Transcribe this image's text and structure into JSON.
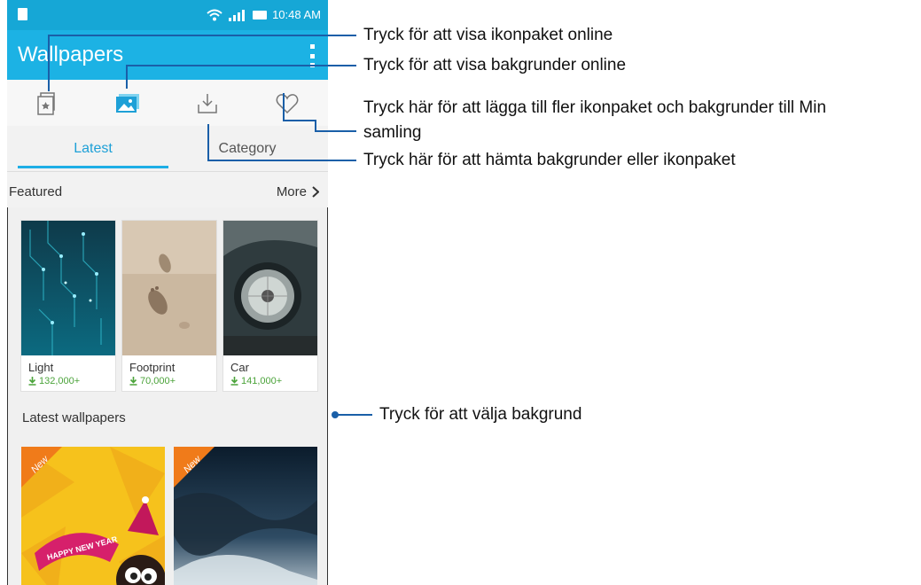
{
  "status_bar": {
    "time": "10:48 AM"
  },
  "app_bar": {
    "title": "Wallpapers"
  },
  "icon_bar": [
    "iconpack-icon",
    "image-icon",
    "download-icon",
    "heart-icon"
  ],
  "tabs": [
    {
      "label": "Latest",
      "active": true
    },
    {
      "label": "Category",
      "active": false
    }
  ],
  "featured": {
    "label": "Featured",
    "more_label": "More"
  },
  "cards": [
    {
      "name": "Light",
      "count": "132,000+"
    },
    {
      "name": "Footprint",
      "count": "70,000+"
    },
    {
      "name": "Car",
      "count": "141,000+"
    }
  ],
  "latest_wallpapers": {
    "label": "Latest wallpapers",
    "badges": [
      "New",
      "New"
    ],
    "card1_text": "HAPPY NEW YEAR"
  },
  "callouts": {
    "c1": "Tryck för att visa ikonpaket online",
    "c2": "Tryck för att visa bakgrunder online",
    "c3a": "Tryck här för att lägga till fler ikonpaket och bakgrunder till Min",
    "c3b": "samling",
    "c4": "Tryck här för att hämta bakgrunder eller ikonpaket",
    "c5": "Tryck för att välja bakgrund"
  },
  "colors": {
    "status_bar": "#16a7d6",
    "app_bar": "#1cb2e4",
    "accent": "#1ea0d7",
    "count_green": "#4ba33a",
    "callout_line": "#1a5fa8"
  }
}
